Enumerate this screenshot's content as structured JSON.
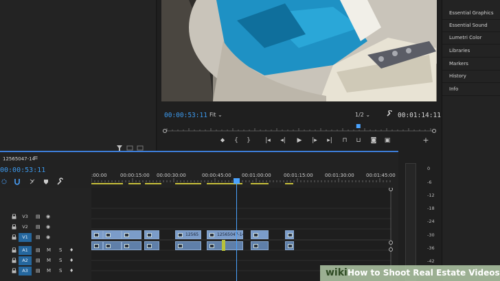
{
  "right_panel": {
    "items": [
      "Essential Graphics",
      "Essential Sound",
      "Lumetri Color",
      "Libraries",
      "Markers",
      "History",
      "Info"
    ]
  },
  "program_monitor": {
    "current_timecode": "00:00:53:11",
    "zoom": "Fit",
    "resolution": "1/2",
    "duration": "00:01:14:11",
    "playhead_fraction": 0.72
  },
  "timeline": {
    "sequence_name": "12565047-14",
    "menu_glyph": "≡",
    "timecode": "00:00:53:11",
    "ruler_labels": [
      ":00:00",
      "00:00:15:00",
      "00:00:30:00",
      "00:00:45:00",
      "00:01:00:00",
      "00:01:15:00",
      "00:01:30:00",
      "00:01:45:00"
    ],
    "tracks": [
      {
        "name": "V3",
        "active": false
      },
      {
        "name": "V2",
        "active": false
      },
      {
        "name": "V1",
        "active": true
      },
      {
        "name": "A1",
        "active": true
      },
      {
        "name": "A2",
        "active": true
      },
      {
        "name": "A3",
        "active": true
      }
    ],
    "track_m": "M",
    "track_s": "S",
    "clip_labels": [
      "12565",
      "12565047-14"
    ]
  },
  "audio_meter": {
    "ticks": [
      "0",
      "-6",
      "-12",
      "-18",
      "-24",
      "-30",
      "-36",
      "-42"
    ]
  },
  "watermark": {
    "logo": "wiki",
    "title": "How to Shoot Real Estate Videos"
  },
  "colors": {
    "accent": "#3d9bf0",
    "clip_video": "#7b9cc9",
    "clip_audio": "#5f7fa9"
  }
}
